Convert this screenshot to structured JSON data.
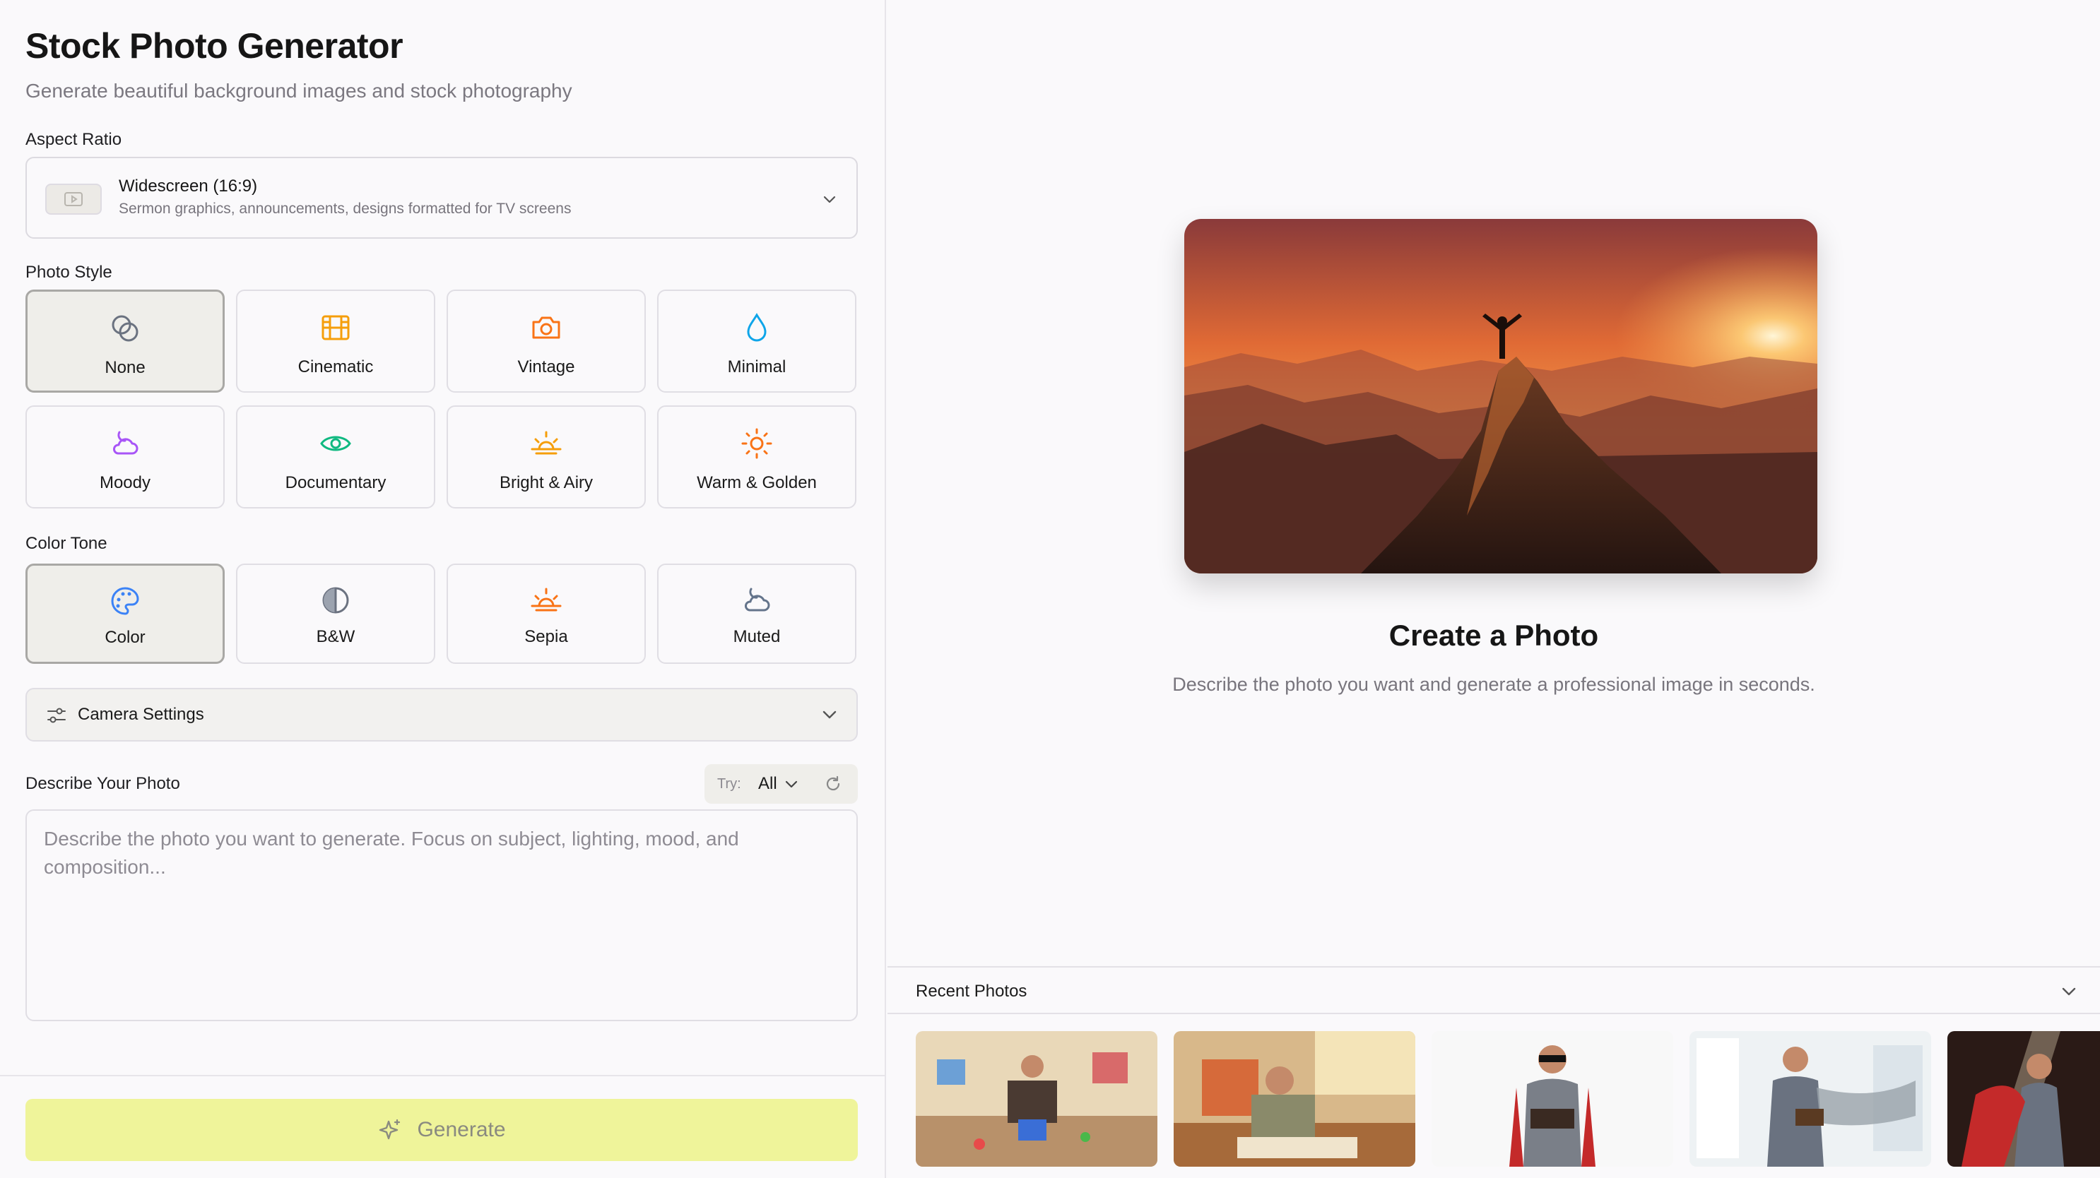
{
  "app": {
    "title": "Stock Photo Generator",
    "subtitle": "Generate beautiful background images and stock photography"
  },
  "aspect_ratio": {
    "label": "Aspect Ratio",
    "selected_name": "Widescreen (16:9)",
    "selected_desc": "Sermon graphics, announcements, designs formatted for TV screens"
  },
  "photo_style": {
    "label": "Photo Style",
    "selected": "None",
    "options": [
      {
        "label": "None",
        "icon": "circles-overlap-icon",
        "color": "#6b7280"
      },
      {
        "label": "Cinematic",
        "icon": "film-icon",
        "color": "#f59e0b"
      },
      {
        "label": "Vintage",
        "icon": "camera-icon",
        "color": "#f97316"
      },
      {
        "label": "Minimal",
        "icon": "droplet-icon",
        "color": "#0ea5e9"
      },
      {
        "label": "Moody",
        "icon": "cloud-moon-icon",
        "color": "#a855f7"
      },
      {
        "label": "Documentary",
        "icon": "eye-icon",
        "color": "#10b981"
      },
      {
        "label": "Bright & Airy",
        "icon": "sunrise-icon",
        "color": "#f59e0b"
      },
      {
        "label": "Warm & Golden",
        "icon": "sun-icon",
        "color": "#f97316"
      }
    ]
  },
  "color_tone": {
    "label": "Color Tone",
    "selected": "Color",
    "options": [
      {
        "label": "Color",
        "icon": "palette-icon",
        "color": "#3b82f6"
      },
      {
        "label": "B&W",
        "icon": "half-circle-icon",
        "color": "#6b7280"
      },
      {
        "label": "Sepia",
        "icon": "sunset-icon",
        "color": "#f97316"
      },
      {
        "label": "Muted",
        "icon": "cloud-sun-icon",
        "color": "#64748b"
      }
    ]
  },
  "camera": {
    "label": "Camera Settings"
  },
  "describe": {
    "label": "Describe Your Photo",
    "try_label": "Try:",
    "try_value": "All",
    "placeholder": "Describe the photo you want to generate. Focus on subject, lighting, mood, and composition..."
  },
  "generate": {
    "label": "Generate",
    "color": "#eff49a"
  },
  "preview": {
    "title": "Create a Photo",
    "subtitle": "Describe the photo you want and generate a professional image in seconds."
  },
  "recent": {
    "label": "Recent Photos"
  }
}
